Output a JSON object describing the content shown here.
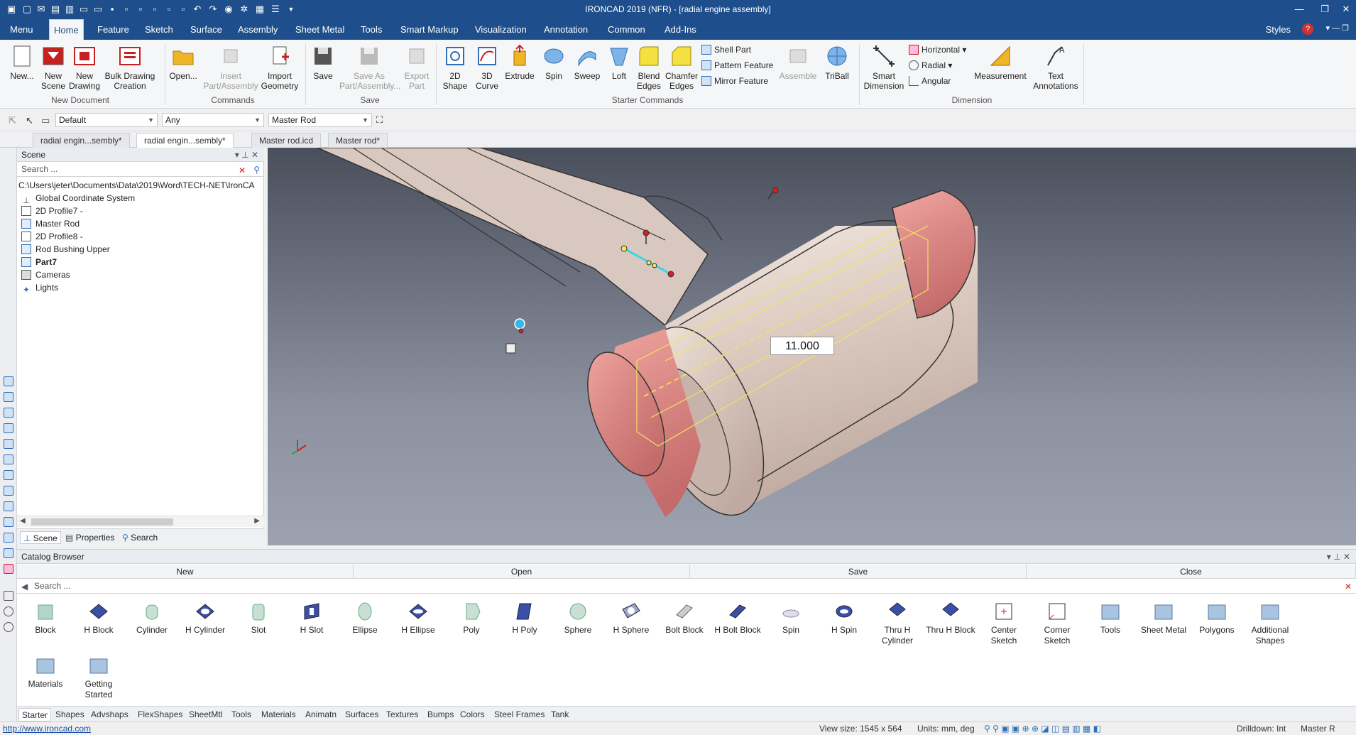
{
  "window": {
    "title": "IRONCAD 2019 (NFR) - [radial engine assembly]"
  },
  "menu_tabs": [
    "Menu",
    "Home",
    "Feature",
    "Sketch",
    "Surface",
    "Assembly",
    "Sheet Metal",
    "Tools",
    "Smart Markup",
    "Visualization",
    "Annotation",
    "Common",
    "Add-Ins"
  ],
  "active_tab": "Home",
  "styles_label": "Styles",
  "ribbon": {
    "new_document": {
      "label": "New Document",
      "buttons": [
        "New...",
        "New Scene",
        "New Drawing",
        "Bulk Drawing Creation"
      ]
    },
    "commands": {
      "label": "Commands",
      "buttons": [
        "Open...",
        "Insert Part/Assembly",
        "Import Geometry"
      ]
    },
    "save": {
      "label": "Save",
      "buttons": [
        "Save",
        "Save As Part/Assembly...",
        "Export Part"
      ]
    },
    "starter": {
      "label": "Starter Commands",
      "buttons": [
        "2D Shape",
        "3D Curve",
        "Extrude",
        "Spin",
        "Sweep",
        "Loft",
        "Blend Edges",
        "Chamfer Edges"
      ],
      "small": [
        "Shell Part",
        "Pattern Feature",
        "Mirror Feature"
      ],
      "more": [
        "Assemble",
        "TriBall"
      ]
    },
    "dimension": {
      "label": "Dimension",
      "smart": "Smart Dimension",
      "small": [
        "Horizontal",
        "Radial",
        "Angular"
      ],
      "measurement": "Measurement",
      "text": "Text Annotations"
    }
  },
  "toolbar2": {
    "style_combo": "Default",
    "filter_combo": "Any",
    "part_combo": "Master Rod"
  },
  "doc_tabs": [
    "radial engin...sembly*",
    "radial engin...sembly*",
    "Master rod.icd",
    "Master rod*"
  ],
  "active_doc_tab": 1,
  "scene": {
    "title": "Scene",
    "search_placeholder": "Search ...",
    "tree": [
      "C:\\Users\\jeter\\Documents\\Data\\2019\\Word\\TECH-NET\\IronCA",
      "Global Coordinate System",
      "2D Profile7 -",
      "Master Rod",
      "2D Profile8 -",
      "Rod Bushing Upper",
      "Part7",
      "Cameras",
      "Lights"
    ],
    "tabs": [
      "Scene",
      "Properties",
      "Search"
    ]
  },
  "viewport": {
    "dimension_value": "11.000"
  },
  "catalog": {
    "title": "Catalog Browser",
    "bar": [
      "New",
      "Open",
      "Save",
      "Close"
    ],
    "search_placeholder": "Search ...",
    "items": [
      "Block",
      "H Block",
      "Cylinder",
      "H Cylinder",
      "Slot",
      "H Slot",
      "Ellipse",
      "H Ellipse",
      "Poly",
      "H Poly",
      "Sphere",
      "H Sphere",
      "Bolt Block",
      "H Bolt Block",
      "Spin",
      "H Spin",
      "Thru H Cylinder",
      "Thru H Block",
      "Center Sketch",
      "Corner Sketch",
      "Tools",
      "Sheet Metal",
      "Polygons",
      "Additional Shapes",
      "Materials",
      "Getting Started"
    ],
    "tabs": [
      "Starter",
      "Shapes",
      "Advshaps",
      "FlexShapes",
      "SheetMtl",
      "Tools",
      "Materials",
      "Animatn",
      "Surfaces",
      "Textures",
      "Bumps",
      "Colors",
      "Steel Frames",
      "Tank"
    ]
  },
  "status": {
    "url": "http://www.ironcad.com",
    "view_size": "View size: 1545 x 564",
    "units": "Units: mm, deg",
    "drilldown": "Drilldown: Int",
    "part": "Master R"
  }
}
